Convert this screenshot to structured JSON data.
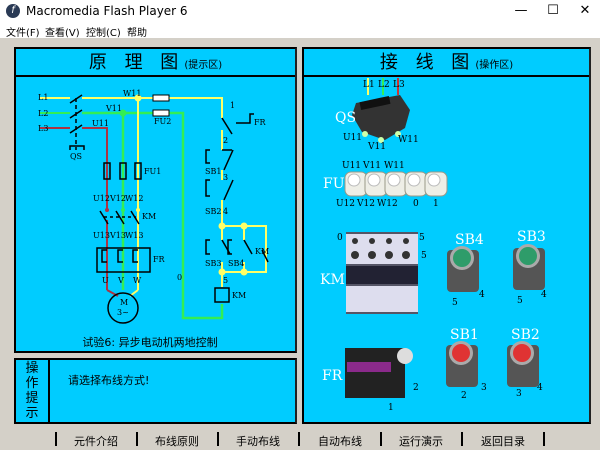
{
  "window": {
    "title": "Macromedia Flash Player 6",
    "minimize": "—",
    "maximize": "☐",
    "close": "✕"
  },
  "menu": [
    "文件(F)",
    "查看(V)",
    "控制(C)",
    "帮助"
  ],
  "left_panel": {
    "title": "原 理 图",
    "subtitle": "(提示区)",
    "caption": "试验6:  异步电动机两地控制",
    "labels": {
      "L1": "L1",
      "L2": "L2",
      "L3": "L3",
      "QS": "QS",
      "U11": "U11",
      "V11": "V11",
      "W11": "W11",
      "FU2": "FU2",
      "FU1": "FU1",
      "U12": "U12",
      "V12": "V12",
      "W12": "W12",
      "KM": "KM",
      "U13": "U13",
      "V13": "V13",
      "W13": "W13",
      "FR": "FR",
      "U": "U",
      "V": "V",
      "W": "W",
      "M": "M",
      "M3": "3~",
      "n0": "0",
      "n1": "1",
      "n2": "2",
      "n3": "3",
      "n4": "4",
      "n5": "5",
      "SB1": "SB1",
      "SB2": "SB2",
      "SB3": "SB3",
      "SB4": "SB4"
    }
  },
  "hint_panel": {
    "label": [
      "操",
      "作",
      "提",
      "示"
    ],
    "message": "请选择布线方式!"
  },
  "right_panel": {
    "title": "接 线 图",
    "subtitle": "(操作区)",
    "labels": {
      "QS": "QS",
      "L1": "L1",
      "L2": "L2",
      "L3": "L3",
      "U11": "U11",
      "V11": "V11",
      "W11": "W11",
      "FU": "FU",
      "U12": "U12",
      "V12": "V12",
      "W12": "W12",
      "f0": "0",
      "f1": "1",
      "KM": "KM",
      "k0": "0",
      "k5a": "5",
      "k5b": "5",
      "SB4": "SB4",
      "SB3": "SB3",
      "SB1": "SB1",
      "SB2": "SB2",
      "FR": "FR",
      "fr1": "1",
      "fr2": "2",
      "s4a": "5",
      "s4b": "4",
      "s3a": "5",
      "s3b": "4",
      "s1a": "2",
      "s1b": "3",
      "s2a": "3",
      "s2b": "4"
    }
  },
  "nav": [
    "元件介绍",
    "布线原则",
    "手动布线",
    "自动布线",
    "运行演示",
    "返回目录"
  ],
  "colors": {
    "panel": "#00ccff",
    "yellow": "#ffff66",
    "green": "#33ee55",
    "red": "#cc3333"
  }
}
